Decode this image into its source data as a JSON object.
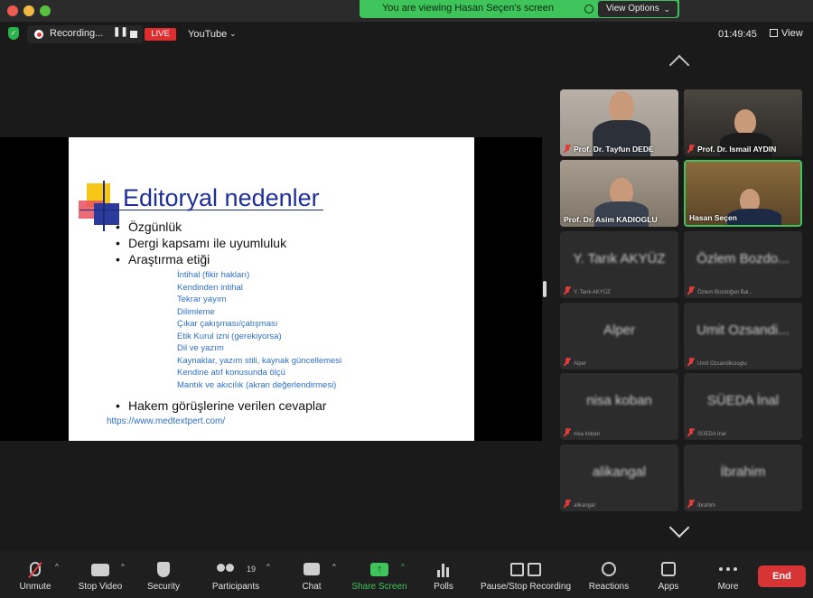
{
  "share_banner": {
    "text": "You are viewing Hasan Seçen's screen",
    "view_options_label": "View Options",
    "view_options_chevron": "⌄"
  },
  "topbar": {
    "recording_label": "Recording...",
    "pause_glyph": "❚❚",
    "live_label": "LIVE",
    "stream_target": "YouTube",
    "stream_chevron": "⌄",
    "clock": "01:49:45",
    "view_label": "View"
  },
  "slide": {
    "title": "Editoryal nedenler",
    "bullet_glyph": "•",
    "bullets": [
      "Özgünlük",
      "Dergi kapsamı ile uyumluluk",
      "Araştırma etiği"
    ],
    "sub_items": [
      "İntihal (fikir hakları)",
      "Kendinden intihal",
      "Tekrar yayım",
      "Dilimleme",
      "Çıkar çakışması/çatışması",
      "Etik Kurul izni (gerekiyorsa)",
      "Dil ve yazım",
      "Kaynaklar, yazım stili, kaynak güncellemesi",
      "Kendine atıf konusunda ölçü",
      "Mantık ve akıcılık (akran değerlendirmesi)"
    ],
    "last_bullet": "Hakem görüşlerine verilen cevaplar",
    "url": "https://www.medtextpert.com/"
  },
  "participants": [
    {
      "name": "Prof. Dr. Tayfun DEDE",
      "video": true,
      "muted": true
    },
    {
      "name": "Prof. Dr. Ismail AYDIN",
      "video": true,
      "muted": true
    },
    {
      "name": "Prof. Dr. Asim KADIOGLU",
      "video": true,
      "muted": false
    },
    {
      "name": "Hasan Seçen",
      "video": true,
      "muted": false,
      "active": true
    },
    {
      "name": "Y. Tarık AKYÜZ",
      "video": false,
      "muted": true
    },
    {
      "name": "Özlem Bozdo...",
      "video": false,
      "muted": true,
      "small_name": "Özlem Bozdoğan Bal..."
    },
    {
      "name": "Alper",
      "video": false,
      "muted": true
    },
    {
      "name": "Umit Ozsandi...",
      "video": false,
      "muted": true,
      "small_name": "Umit Ozsandikcioglu"
    },
    {
      "name": "nisa koban",
      "video": false,
      "muted": true
    },
    {
      "name": "SÜEDA İnal",
      "video": false,
      "muted": true
    },
    {
      "name": "alikangal",
      "video": false,
      "muted": true
    },
    {
      "name": "İbrahim",
      "video": false,
      "muted": true
    }
  ],
  "toolbar": {
    "caret": "^",
    "unmute": "Unmute",
    "stop_video": "Stop Video",
    "security": "Security",
    "participants": "Participants",
    "participants_count": "19",
    "chat": "Chat",
    "share_screen": "Share Screen",
    "share_glyph": "↑",
    "polls": "Polls",
    "pause_stop_recording": "Pause/Stop Recording",
    "reactions": "Reactions",
    "apps": "Apps",
    "more": "More",
    "end": "End"
  },
  "colors": {
    "share_green": "#3ec45a",
    "live_red": "#e02d2d",
    "end_red": "#d73535",
    "slide_title_blue": "#1e2f9a",
    "slide_link_blue": "#2f6fc8"
  }
}
